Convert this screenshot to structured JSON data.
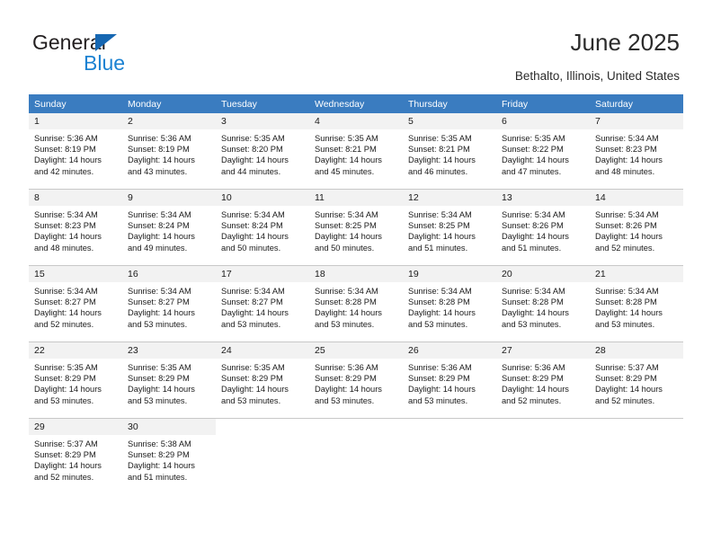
{
  "logo": {
    "word_general": "General",
    "word_blue": "Blue",
    "triangle_color": "#1667b2",
    "blue_color": "#1b82d2"
  },
  "header": {
    "title": "June 2025",
    "location": "Bethalto, Illinois, United States",
    "header_bg": "#3a7cc0",
    "daynum_bg": "#f2f2f2"
  },
  "weekday_headers": [
    "Sunday",
    "Monday",
    "Tuesday",
    "Wednesday",
    "Thursday",
    "Friday",
    "Saturday"
  ],
  "weeks": [
    [
      {
        "day": "1",
        "sunrise": "Sunrise: 5:36 AM",
        "sunset": "Sunset: 8:19 PM",
        "daylight1": "Daylight: 14 hours",
        "daylight2": "and 42 minutes."
      },
      {
        "day": "2",
        "sunrise": "Sunrise: 5:36 AM",
        "sunset": "Sunset: 8:19 PM",
        "daylight1": "Daylight: 14 hours",
        "daylight2": "and 43 minutes."
      },
      {
        "day": "3",
        "sunrise": "Sunrise: 5:35 AM",
        "sunset": "Sunset: 8:20 PM",
        "daylight1": "Daylight: 14 hours",
        "daylight2": "and 44 minutes."
      },
      {
        "day": "4",
        "sunrise": "Sunrise: 5:35 AM",
        "sunset": "Sunset: 8:21 PM",
        "daylight1": "Daylight: 14 hours",
        "daylight2": "and 45 minutes."
      },
      {
        "day": "5",
        "sunrise": "Sunrise: 5:35 AM",
        "sunset": "Sunset: 8:21 PM",
        "daylight1": "Daylight: 14 hours",
        "daylight2": "and 46 minutes."
      },
      {
        "day": "6",
        "sunrise": "Sunrise: 5:35 AM",
        "sunset": "Sunset: 8:22 PM",
        "daylight1": "Daylight: 14 hours",
        "daylight2": "and 47 minutes."
      },
      {
        "day": "7",
        "sunrise": "Sunrise: 5:34 AM",
        "sunset": "Sunset: 8:23 PM",
        "daylight1": "Daylight: 14 hours",
        "daylight2": "and 48 minutes."
      }
    ],
    [
      {
        "day": "8",
        "sunrise": "Sunrise: 5:34 AM",
        "sunset": "Sunset: 8:23 PM",
        "daylight1": "Daylight: 14 hours",
        "daylight2": "and 48 minutes."
      },
      {
        "day": "9",
        "sunrise": "Sunrise: 5:34 AM",
        "sunset": "Sunset: 8:24 PM",
        "daylight1": "Daylight: 14 hours",
        "daylight2": "and 49 minutes."
      },
      {
        "day": "10",
        "sunrise": "Sunrise: 5:34 AM",
        "sunset": "Sunset: 8:24 PM",
        "daylight1": "Daylight: 14 hours",
        "daylight2": "and 50 minutes."
      },
      {
        "day": "11",
        "sunrise": "Sunrise: 5:34 AM",
        "sunset": "Sunset: 8:25 PM",
        "daylight1": "Daylight: 14 hours",
        "daylight2": "and 50 minutes."
      },
      {
        "day": "12",
        "sunrise": "Sunrise: 5:34 AM",
        "sunset": "Sunset: 8:25 PM",
        "daylight1": "Daylight: 14 hours",
        "daylight2": "and 51 minutes."
      },
      {
        "day": "13",
        "sunrise": "Sunrise: 5:34 AM",
        "sunset": "Sunset: 8:26 PM",
        "daylight1": "Daylight: 14 hours",
        "daylight2": "and 51 minutes."
      },
      {
        "day": "14",
        "sunrise": "Sunrise: 5:34 AM",
        "sunset": "Sunset: 8:26 PM",
        "daylight1": "Daylight: 14 hours",
        "daylight2": "and 52 minutes."
      }
    ],
    [
      {
        "day": "15",
        "sunrise": "Sunrise: 5:34 AM",
        "sunset": "Sunset: 8:27 PM",
        "daylight1": "Daylight: 14 hours",
        "daylight2": "and 52 minutes."
      },
      {
        "day": "16",
        "sunrise": "Sunrise: 5:34 AM",
        "sunset": "Sunset: 8:27 PM",
        "daylight1": "Daylight: 14 hours",
        "daylight2": "and 53 minutes."
      },
      {
        "day": "17",
        "sunrise": "Sunrise: 5:34 AM",
        "sunset": "Sunset: 8:27 PM",
        "daylight1": "Daylight: 14 hours",
        "daylight2": "and 53 minutes."
      },
      {
        "day": "18",
        "sunrise": "Sunrise: 5:34 AM",
        "sunset": "Sunset: 8:28 PM",
        "daylight1": "Daylight: 14 hours",
        "daylight2": "and 53 minutes."
      },
      {
        "day": "19",
        "sunrise": "Sunrise: 5:34 AM",
        "sunset": "Sunset: 8:28 PM",
        "daylight1": "Daylight: 14 hours",
        "daylight2": "and 53 minutes."
      },
      {
        "day": "20",
        "sunrise": "Sunrise: 5:34 AM",
        "sunset": "Sunset: 8:28 PM",
        "daylight1": "Daylight: 14 hours",
        "daylight2": "and 53 minutes."
      },
      {
        "day": "21",
        "sunrise": "Sunrise: 5:34 AM",
        "sunset": "Sunset: 8:28 PM",
        "daylight1": "Daylight: 14 hours",
        "daylight2": "and 53 minutes."
      }
    ],
    [
      {
        "day": "22",
        "sunrise": "Sunrise: 5:35 AM",
        "sunset": "Sunset: 8:29 PM",
        "daylight1": "Daylight: 14 hours",
        "daylight2": "and 53 minutes."
      },
      {
        "day": "23",
        "sunrise": "Sunrise: 5:35 AM",
        "sunset": "Sunset: 8:29 PM",
        "daylight1": "Daylight: 14 hours",
        "daylight2": "and 53 minutes."
      },
      {
        "day": "24",
        "sunrise": "Sunrise: 5:35 AM",
        "sunset": "Sunset: 8:29 PM",
        "daylight1": "Daylight: 14 hours",
        "daylight2": "and 53 minutes."
      },
      {
        "day": "25",
        "sunrise": "Sunrise: 5:36 AM",
        "sunset": "Sunset: 8:29 PM",
        "daylight1": "Daylight: 14 hours",
        "daylight2": "and 53 minutes."
      },
      {
        "day": "26",
        "sunrise": "Sunrise: 5:36 AM",
        "sunset": "Sunset: 8:29 PM",
        "daylight1": "Daylight: 14 hours",
        "daylight2": "and 53 minutes."
      },
      {
        "day": "27",
        "sunrise": "Sunrise: 5:36 AM",
        "sunset": "Sunset: 8:29 PM",
        "daylight1": "Daylight: 14 hours",
        "daylight2": "and 52 minutes."
      },
      {
        "day": "28",
        "sunrise": "Sunrise: 5:37 AM",
        "sunset": "Sunset: 8:29 PM",
        "daylight1": "Daylight: 14 hours",
        "daylight2": "and 52 minutes."
      }
    ],
    [
      {
        "day": "29",
        "sunrise": "Sunrise: 5:37 AM",
        "sunset": "Sunset: 8:29 PM",
        "daylight1": "Daylight: 14 hours",
        "daylight2": "and 52 minutes."
      },
      {
        "day": "30",
        "sunrise": "Sunrise: 5:38 AM",
        "sunset": "Sunset: 8:29 PM",
        "daylight1": "Daylight: 14 hours",
        "daylight2": "and 51 minutes."
      },
      {
        "day": "",
        "sunrise": "",
        "sunset": "",
        "daylight1": "",
        "daylight2": ""
      },
      {
        "day": "",
        "sunrise": "",
        "sunset": "",
        "daylight1": "",
        "daylight2": ""
      },
      {
        "day": "",
        "sunrise": "",
        "sunset": "",
        "daylight1": "",
        "daylight2": ""
      },
      {
        "day": "",
        "sunrise": "",
        "sunset": "",
        "daylight1": "",
        "daylight2": ""
      },
      {
        "day": "",
        "sunrise": "",
        "sunset": "",
        "daylight1": "",
        "daylight2": ""
      }
    ]
  ]
}
